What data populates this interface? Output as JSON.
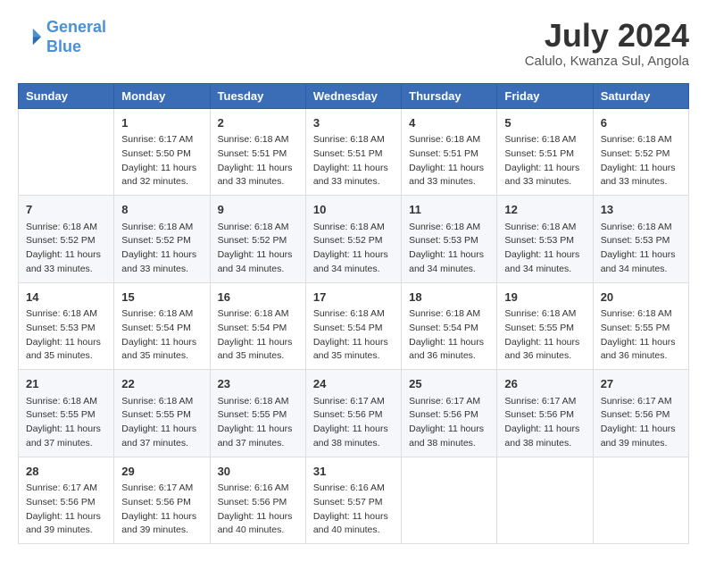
{
  "header": {
    "logo_line1": "General",
    "logo_line2": "Blue",
    "month_year": "July 2024",
    "location": "Calulo, Kwanza Sul, Angola"
  },
  "weekdays": [
    "Sunday",
    "Monday",
    "Tuesday",
    "Wednesday",
    "Thursday",
    "Friday",
    "Saturday"
  ],
  "weeks": [
    [
      {
        "day": "",
        "text": ""
      },
      {
        "day": "1",
        "text": "Sunrise: 6:17 AM\nSunset: 5:50 PM\nDaylight: 11 hours\nand 32 minutes."
      },
      {
        "day": "2",
        "text": "Sunrise: 6:18 AM\nSunset: 5:51 PM\nDaylight: 11 hours\nand 33 minutes."
      },
      {
        "day": "3",
        "text": "Sunrise: 6:18 AM\nSunset: 5:51 PM\nDaylight: 11 hours\nand 33 minutes."
      },
      {
        "day": "4",
        "text": "Sunrise: 6:18 AM\nSunset: 5:51 PM\nDaylight: 11 hours\nand 33 minutes."
      },
      {
        "day": "5",
        "text": "Sunrise: 6:18 AM\nSunset: 5:51 PM\nDaylight: 11 hours\nand 33 minutes."
      },
      {
        "day": "6",
        "text": "Sunrise: 6:18 AM\nSunset: 5:52 PM\nDaylight: 11 hours\nand 33 minutes."
      }
    ],
    [
      {
        "day": "7",
        "text": "Sunrise: 6:18 AM\nSunset: 5:52 PM\nDaylight: 11 hours\nand 33 minutes."
      },
      {
        "day": "8",
        "text": "Sunrise: 6:18 AM\nSunset: 5:52 PM\nDaylight: 11 hours\nand 33 minutes."
      },
      {
        "day": "9",
        "text": "Sunrise: 6:18 AM\nSunset: 5:52 PM\nDaylight: 11 hours\nand 34 minutes."
      },
      {
        "day": "10",
        "text": "Sunrise: 6:18 AM\nSunset: 5:52 PM\nDaylight: 11 hours\nand 34 minutes."
      },
      {
        "day": "11",
        "text": "Sunrise: 6:18 AM\nSunset: 5:53 PM\nDaylight: 11 hours\nand 34 minutes."
      },
      {
        "day": "12",
        "text": "Sunrise: 6:18 AM\nSunset: 5:53 PM\nDaylight: 11 hours\nand 34 minutes."
      },
      {
        "day": "13",
        "text": "Sunrise: 6:18 AM\nSunset: 5:53 PM\nDaylight: 11 hours\nand 34 minutes."
      }
    ],
    [
      {
        "day": "14",
        "text": "Sunrise: 6:18 AM\nSunset: 5:53 PM\nDaylight: 11 hours\nand 35 minutes."
      },
      {
        "day": "15",
        "text": "Sunrise: 6:18 AM\nSunset: 5:54 PM\nDaylight: 11 hours\nand 35 minutes."
      },
      {
        "day": "16",
        "text": "Sunrise: 6:18 AM\nSunset: 5:54 PM\nDaylight: 11 hours\nand 35 minutes."
      },
      {
        "day": "17",
        "text": "Sunrise: 6:18 AM\nSunset: 5:54 PM\nDaylight: 11 hours\nand 35 minutes."
      },
      {
        "day": "18",
        "text": "Sunrise: 6:18 AM\nSunset: 5:54 PM\nDaylight: 11 hours\nand 36 minutes."
      },
      {
        "day": "19",
        "text": "Sunrise: 6:18 AM\nSunset: 5:55 PM\nDaylight: 11 hours\nand 36 minutes."
      },
      {
        "day": "20",
        "text": "Sunrise: 6:18 AM\nSunset: 5:55 PM\nDaylight: 11 hours\nand 36 minutes."
      }
    ],
    [
      {
        "day": "21",
        "text": "Sunrise: 6:18 AM\nSunset: 5:55 PM\nDaylight: 11 hours\nand 37 minutes."
      },
      {
        "day": "22",
        "text": "Sunrise: 6:18 AM\nSunset: 5:55 PM\nDaylight: 11 hours\nand 37 minutes."
      },
      {
        "day": "23",
        "text": "Sunrise: 6:18 AM\nSunset: 5:55 PM\nDaylight: 11 hours\nand 37 minutes."
      },
      {
        "day": "24",
        "text": "Sunrise: 6:17 AM\nSunset: 5:56 PM\nDaylight: 11 hours\nand 38 minutes."
      },
      {
        "day": "25",
        "text": "Sunrise: 6:17 AM\nSunset: 5:56 PM\nDaylight: 11 hours\nand 38 minutes."
      },
      {
        "day": "26",
        "text": "Sunrise: 6:17 AM\nSunset: 5:56 PM\nDaylight: 11 hours\nand 38 minutes."
      },
      {
        "day": "27",
        "text": "Sunrise: 6:17 AM\nSunset: 5:56 PM\nDaylight: 11 hours\nand 39 minutes."
      }
    ],
    [
      {
        "day": "28",
        "text": "Sunrise: 6:17 AM\nSunset: 5:56 PM\nDaylight: 11 hours\nand 39 minutes."
      },
      {
        "day": "29",
        "text": "Sunrise: 6:17 AM\nSunset: 5:56 PM\nDaylight: 11 hours\nand 39 minutes."
      },
      {
        "day": "30",
        "text": "Sunrise: 6:16 AM\nSunset: 5:56 PM\nDaylight: 11 hours\nand 40 minutes."
      },
      {
        "day": "31",
        "text": "Sunrise: 6:16 AM\nSunset: 5:57 PM\nDaylight: 11 hours\nand 40 minutes."
      },
      {
        "day": "",
        "text": ""
      },
      {
        "day": "",
        "text": ""
      },
      {
        "day": "",
        "text": ""
      }
    ]
  ]
}
